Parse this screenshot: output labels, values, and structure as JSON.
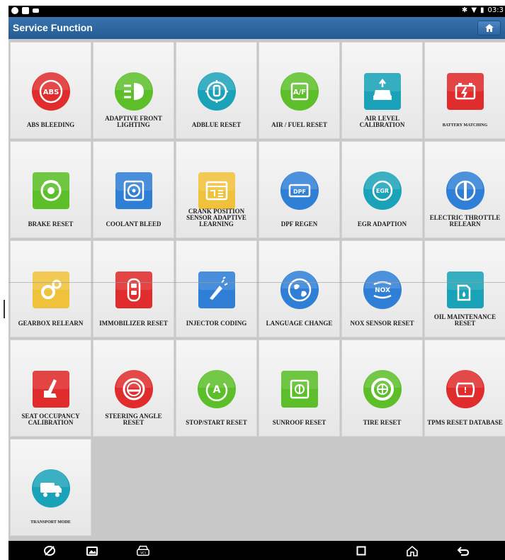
{
  "status_bar": {
    "time": "03:3"
  },
  "header": {
    "title": "Service Function"
  },
  "tiles": [
    {
      "label": "ABS BLEEDING",
      "icon": "abs-icon",
      "color": "#e02c2c"
    },
    {
      "label": "ADAPTIVE FRONT LIGHTING",
      "icon": "headlight-icon",
      "color": "#5cbf2a"
    },
    {
      "label": "ADBLUE RESET",
      "icon": "adblue-icon",
      "color": "#1aa3b8"
    },
    {
      "label": "AIR / FUEL RESET",
      "icon": "air-fuel-icon",
      "color": "#5cbf2a"
    },
    {
      "label": "AIR LEVEL CALIBRATION",
      "icon": "air-suspension-icon",
      "color": "#1aa3b8"
    },
    {
      "label": "BATTERY MATCHING",
      "icon": "battery-icon",
      "color": "#e02c2c"
    },
    {
      "label": "BRAKE RESET",
      "icon": "brake-disc-icon",
      "color": "#5cbf2a"
    },
    {
      "label": "COOLANT BLEED",
      "icon": "coolant-fan-icon",
      "color": "#2f7fd6"
    },
    {
      "label": "CRANK POSITION SENSOR ADAPTIVE LEARNING",
      "icon": "crank-sensor-icon",
      "color": "#f0c23c"
    },
    {
      "label": "DPF REGEN",
      "icon": "dpf-icon",
      "color": "#2f7fd6"
    },
    {
      "label": "EGR ADAPTION",
      "icon": "egr-icon",
      "color": "#1aa3b8"
    },
    {
      "label": "ELECTRIC THROTTLE RELEARN",
      "icon": "throttle-icon",
      "color": "#2f7fd6"
    },
    {
      "label": "GEARBOX RELEARN",
      "icon": "gears-icon",
      "color": "#f0c23c"
    },
    {
      "label": "IMMOBILIZER RESET",
      "icon": "car-key-icon",
      "color": "#e02c2c"
    },
    {
      "label": "INJECTOR CODING",
      "icon": "injector-icon",
      "color": "#2f7fd6"
    },
    {
      "label": "LANGUAGE CHANGE",
      "icon": "globe-icon",
      "color": "#2f7fd6"
    },
    {
      "label": "NOX SENSOR RESET",
      "icon": "nox-icon",
      "color": "#2f7fd6"
    },
    {
      "label": "OIL MAINTENANCE RESET",
      "icon": "oil-can-icon",
      "color": "#1aa3b8"
    },
    {
      "label": "SEAT OCCUPANCY CALIBRATION",
      "icon": "seat-icon",
      "color": "#e02c2c"
    },
    {
      "label": "STEERING ANGLE RESET",
      "icon": "steering-wheel-icon",
      "color": "#e02c2c"
    },
    {
      "label": "STOP/START RESET",
      "icon": "start-stop-icon",
      "color": "#5cbf2a"
    },
    {
      "label": "SUNROOF RESET",
      "icon": "sunroof-icon",
      "color": "#5cbf2a"
    },
    {
      "label": "TIRE RESET",
      "icon": "tire-icon",
      "color": "#5cbf2a"
    },
    {
      "label": "TPMS RESET DATABASE",
      "icon": "tpms-icon",
      "color": "#e02c2c"
    },
    {
      "label": "TRANSPORT MODE",
      "icon": "transport-truck-icon",
      "color": "#1aa3b8"
    }
  ],
  "nav_bar": {
    "buttons": [
      "browser-icon",
      "gallery-icon",
      "vci-icon",
      "recent-apps-icon",
      "home-icon",
      "back-icon"
    ]
  }
}
